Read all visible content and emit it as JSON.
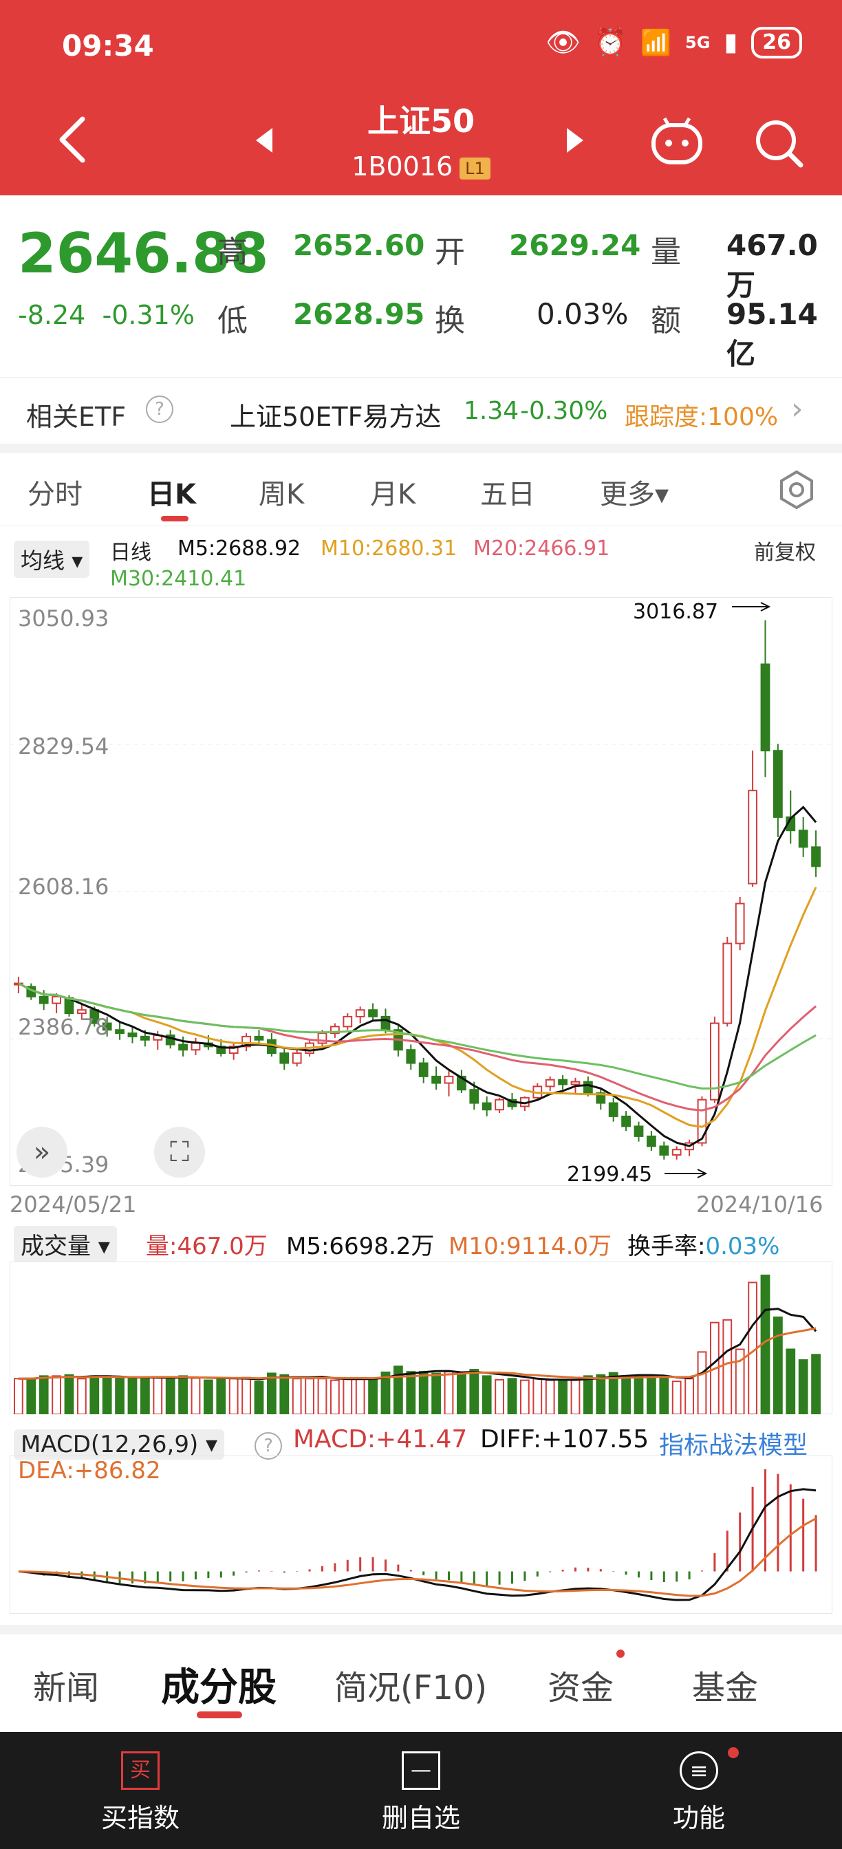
{
  "status": {
    "time": "09:34",
    "network": "5G",
    "battery": "26"
  },
  "header": {
    "title": "上证50",
    "code": "1B0016",
    "level": "L1"
  },
  "quote": {
    "price": "2646.88",
    "change": "-8.24",
    "change_pct": "-0.31%",
    "high_label": "高",
    "high": "2652.60",
    "open_label": "开",
    "open": "2629.24",
    "vol_label": "量",
    "vol": "467.0万",
    "low_label": "低",
    "low": "2628.95",
    "turn_label": "换",
    "turn": "0.03%",
    "amt_label": "额",
    "amt": "95.14亿"
  },
  "etf": {
    "label": "相关ETF",
    "name": "上证50ETF易方达",
    "price": "1.34",
    "pct": "-0.30%",
    "track": "跟踪度:100%"
  },
  "chart_tabs": [
    {
      "label": "分时"
    },
    {
      "label": "日K"
    },
    {
      "label": "周K"
    },
    {
      "label": "月K"
    },
    {
      "label": "五日"
    },
    {
      "label": "更多▾"
    }
  ],
  "ma": {
    "selector": "均线",
    "period": "日线",
    "m5": "M5:2688.92",
    "m10": "M10:2680.31",
    "m20": "M20:2466.91",
    "m30": "M30:2410.41",
    "fq": "前复权"
  },
  "kchart": {
    "y_ticks": [
      "3050.93",
      "2829.54",
      "2608.16",
      "2386.78",
      "2165.39"
    ],
    "max_label": "3016.87",
    "min_label": "2199.45",
    "start_date": "2024/05/21",
    "end_date": "2024/10/16"
  },
  "volume": {
    "selector": "成交量",
    "vol": "量:467.0万",
    "m5": "M5:6698.2万",
    "m10": "M10:9114.0万",
    "turnover_label": "换手率:",
    "turnover": "0.03%"
  },
  "macd": {
    "selector": "MACD(12,26,9)",
    "macd": "MACD:+41.47",
    "diff": "DIFF:+107.55",
    "link": "指标战法模型",
    "dea": "DEA:+86.82"
  },
  "bottom_tabs": [
    {
      "label": "新闻"
    },
    {
      "label": "成分股"
    },
    {
      "label": "简况(F10)"
    },
    {
      "label": "资金"
    },
    {
      "label": "基金"
    }
  ],
  "nav": [
    {
      "label": "买指数",
      "icon_char": "买"
    },
    {
      "label": "删自选",
      "icon_char": "—"
    },
    {
      "label": "功能",
      "icon_char": "≡"
    }
  ],
  "colors": {
    "header_red": "#e03c3c",
    "up": "#d23c3c",
    "down": "#2e7d1e",
    "m5": "#111111",
    "m10": "#e0a020",
    "m20": "#e06070",
    "m30": "#6cc060"
  },
  "chart_data": {
    "type": "candlestick",
    "x_range": [
      "2024/05/21",
      "2024/10/16"
    ],
    "y_range": [
      2165.39,
      3050.93
    ],
    "ohlc_approx": [
      [
        2470,
        2480,
        2455,
        2470
      ],
      [
        2465,
        2470,
        2445,
        2450
      ],
      [
        2450,
        2460,
        2430,
        2440
      ],
      [
        2440,
        2455,
        2425,
        2450
      ],
      [
        2448,
        2452,
        2420,
        2425
      ],
      [
        2425,
        2440,
        2415,
        2430
      ],
      [
        2430,
        2435,
        2405,
        2410
      ],
      [
        2410,
        2420,
        2390,
        2400
      ],
      [
        2400,
        2412,
        2385,
        2395
      ],
      [
        2395,
        2405,
        2380,
        2390
      ],
      [
        2390,
        2400,
        2375,
        2385
      ],
      [
        2385,
        2398,
        2370,
        2392
      ],
      [
        2392,
        2400,
        2372,
        2378
      ],
      [
        2378,
        2390,
        2360,
        2370
      ],
      [
        2370,
        2388,
        2362,
        2380
      ],
      [
        2380,
        2392,
        2370,
        2375
      ],
      [
        2375,
        2386,
        2360,
        2365
      ],
      [
        2365,
        2380,
        2355,
        2375
      ],
      [
        2375,
        2395,
        2368,
        2390
      ],
      [
        2390,
        2400,
        2380,
        2385
      ],
      [
        2385,
        2395,
        2360,
        2365
      ],
      [
        2365,
        2372,
        2340,
        2350
      ],
      [
        2350,
        2370,
        2345,
        2365
      ],
      [
        2365,
        2385,
        2360,
        2380
      ],
      [
        2380,
        2400,
        2375,
        2395
      ],
      [
        2395,
        2410,
        2388,
        2405
      ],
      [
        2405,
        2425,
        2400,
        2420
      ],
      [
        2420,
        2435,
        2410,
        2430
      ],
      [
        2430,
        2440,
        2415,
        2420
      ],
      [
        2420,
        2432,
        2395,
        2400
      ],
      [
        2400,
        2408,
        2360,
        2370
      ],
      [
        2370,
        2378,
        2340,
        2350
      ],
      [
        2350,
        2358,
        2320,
        2330
      ],
      [
        2330,
        2345,
        2310,
        2320
      ],
      [
        2320,
        2338,
        2300,
        2330
      ],
      [
        2330,
        2340,
        2305,
        2310
      ],
      [
        2310,
        2322,
        2280,
        2290
      ],
      [
        2290,
        2300,
        2270,
        2280
      ],
      [
        2280,
        2298,
        2275,
        2295
      ],
      [
        2295,
        2305,
        2280,
        2285
      ],
      [
        2285,
        2300,
        2278,
        2298
      ],
      [
        2298,
        2320,
        2295,
        2315
      ],
      [
        2315,
        2330,
        2308,
        2325
      ],
      [
        2325,
        2332,
        2310,
        2318
      ],
      [
        2318,
        2328,
        2305,
        2322
      ],
      [
        2322,
        2330,
        2300,
        2305
      ],
      [
        2305,
        2312,
        2280,
        2290
      ],
      [
        2290,
        2298,
        2262,
        2270
      ],
      [
        2270,
        2278,
        2248,
        2255
      ],
      [
        2255,
        2262,
        2232,
        2240
      ],
      [
        2240,
        2248,
        2218,
        2225
      ],
      [
        2225,
        2232,
        2205,
        2212
      ],
      [
        2212,
        2225,
        2205,
        2220
      ],
      [
        2220,
        2235,
        2210,
        2230
      ],
      [
        2230,
        2300,
        2225,
        2295
      ],
      [
        2295,
        2420,
        2290,
        2410
      ],
      [
        2410,
        2540,
        2405,
        2530
      ],
      [
        2530,
        2600,
        2520,
        2590
      ],
      [
        2620,
        2820,
        2615,
        2760
      ],
      [
        2950,
        3016,
        2780,
        2820
      ],
      [
        2820,
        2830,
        2690,
        2720
      ],
      [
        2720,
        2760,
        2680,
        2700
      ],
      [
        2700,
        2720,
        2660,
        2675
      ],
      [
        2675,
        2700,
        2630,
        2646
      ]
    ]
  }
}
